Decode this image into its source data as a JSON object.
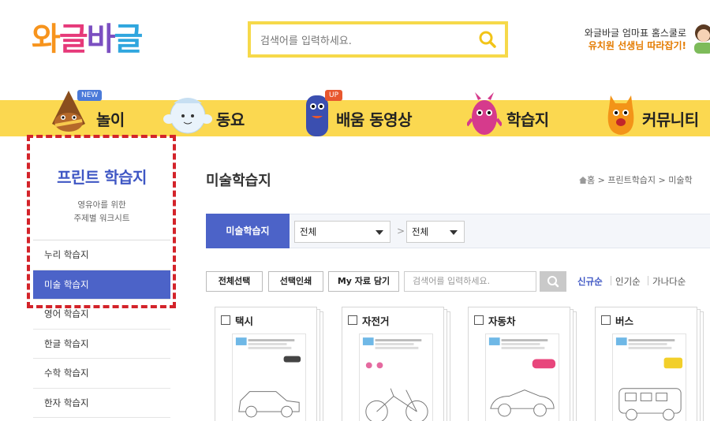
{
  "header": {
    "logo_text": "와글바글",
    "search_placeholder": "검색어를 입력하세요.",
    "promo_line1": "와글바글 엄마표 홈스쿨로",
    "promo_line2": "유치원 선생님 따라잡기!"
  },
  "nav": {
    "items": [
      {
        "label": "놀이",
        "badge": "NEW"
      },
      {
        "label": "동요",
        "badge": ""
      },
      {
        "label": "배움 동영상",
        "badge": "UP"
      },
      {
        "label": "학습지",
        "badge": ""
      },
      {
        "label": "커뮤니티",
        "badge": ""
      }
    ]
  },
  "sidebar": {
    "title": "프린트 학습지",
    "subtitle_line1": "영유아를 위한",
    "subtitle_line2": "주제별 워크시트",
    "items": [
      {
        "label": "누리 학습지",
        "active": false
      },
      {
        "label": "미술 학습지",
        "active": true
      },
      {
        "label": "영어 학습지",
        "active": false
      },
      {
        "label": "한글 학습지",
        "active": false
      },
      {
        "label": "수학 학습지",
        "active": false
      },
      {
        "label": "한자 학습지",
        "active": false
      }
    ]
  },
  "main": {
    "title": "미술학습지",
    "breadcrumb": "홈 > 프린트학습지 > 미술학",
    "filter": {
      "tab_label": "미술학습지",
      "select1_value": "전체",
      "select2_value": "전체",
      "separator": ">"
    },
    "toolbar": {
      "select_all": "전체선택",
      "print_selected": "선택인쇄",
      "my_save": "My 자료 담기",
      "search_placeholder": "검색어를 입력하세요."
    },
    "sort": [
      "신규순",
      "인기순",
      "가나다순"
    ],
    "cards": [
      {
        "name": "택시"
      },
      {
        "name": "자전거"
      },
      {
        "name": "자동차"
      },
      {
        "name": "버스"
      }
    ]
  },
  "colors": {
    "nav_yellow": "#fbd850",
    "accent_blue": "#4c63c8",
    "search_border": "#f6d94a",
    "highlight_red": "#d3232a"
  }
}
